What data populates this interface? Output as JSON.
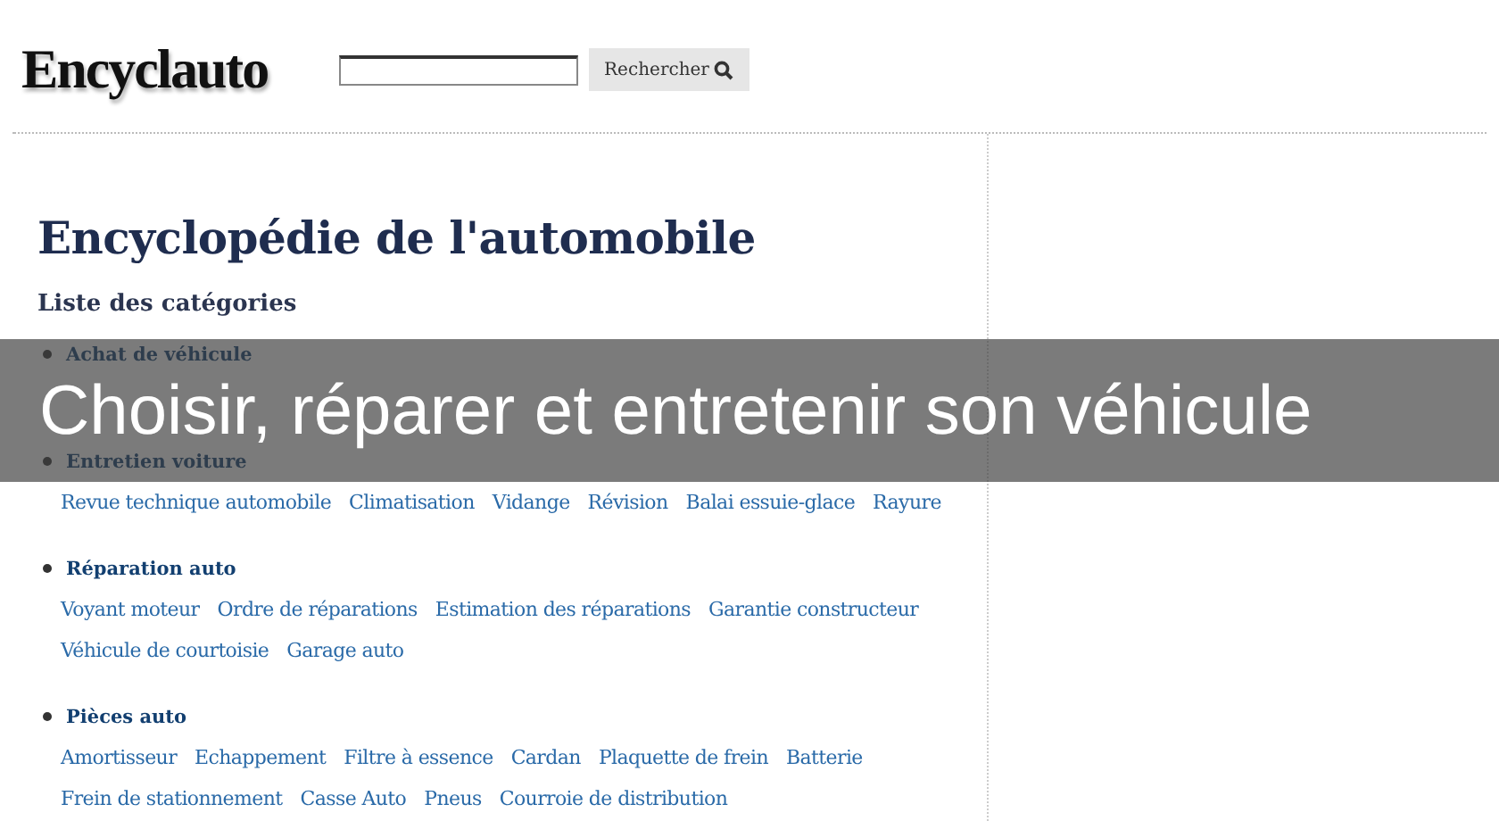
{
  "header": {
    "logo": "Encyclauto",
    "search": {
      "button": "Rechercher"
    }
  },
  "page": {
    "title": "Encyclopédie de l'automobile",
    "subtitle": "Liste des catégories",
    "categories": [
      {
        "name": "Achat de véhicule"
      },
      {
        "name": "Entretien voiture",
        "links": [
          [
            "Revue technique automobile",
            "Climatisation",
            "Vidange",
            "Révision",
            "Balai essuie-glace",
            "Rayure"
          ]
        ]
      },
      {
        "name": "Réparation auto",
        "links": [
          [
            "Voyant moteur",
            "Ordre de réparations",
            "Estimation des réparations",
            "Garantie constructeur"
          ],
          [
            "Véhicule de courtoisie",
            "Garage auto"
          ]
        ]
      },
      {
        "name": "Pièces auto",
        "links": [
          [
            "Amortisseur",
            "Echappement",
            "Filtre à essence",
            "Cardan",
            "Plaquette de frein",
            "Batterie"
          ],
          [
            "Frein de stationnement",
            "Casse Auto",
            "Pneus",
            "Courroie de distribution"
          ]
        ]
      }
    ]
  },
  "banner": {
    "text": "Choisir, réparer et entretenir son véhicule"
  }
}
